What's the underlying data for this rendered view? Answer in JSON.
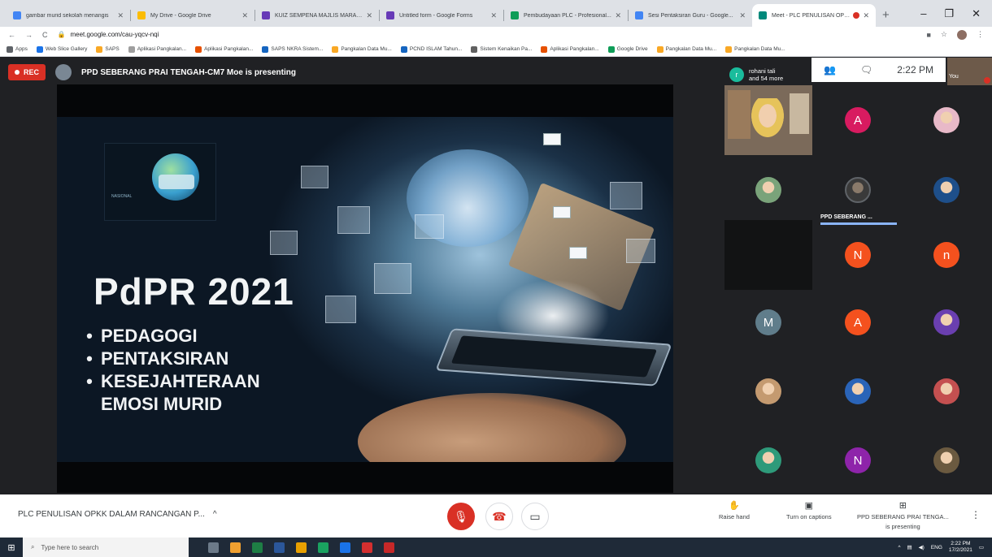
{
  "browser": {
    "tabs": [
      {
        "title": "gambar murid sekolah menangis",
        "color": "#4285f4"
      },
      {
        "title": "My Drive - Google Drive",
        "color": "#fbbc04"
      },
      {
        "title": "KUIZ SEMPENA MAJLIS MARAH...",
        "color": "#673ab7"
      },
      {
        "title": "Untitled form - Google Forms",
        "color": "#673ab7"
      },
      {
        "title": "Pembudayaan PLC - Profesional...",
        "color": "#0f9d58"
      },
      {
        "title": "Sesi Pentaksiran Guru - Google...",
        "color": "#4285f4"
      },
      {
        "title": "Meet - PLC PENULISAN OPK...",
        "color": "#00897b",
        "active": true
      }
    ],
    "new_tab": "+",
    "url": "meet.google.com/cau-yqcv-nqi",
    "bookmarks": [
      {
        "label": "Apps",
        "color": "#5f6368"
      },
      {
        "label": "Web Slice Gallery",
        "color": "#1a73e8"
      },
      {
        "label": "SAPS",
        "color": "#f9a825"
      },
      {
        "label": "Aplikasi Pangkalan...",
        "color": "#9e9e9e"
      },
      {
        "label": "Aplikasi Pangkalan...",
        "color": "#e65100"
      },
      {
        "label": "SAPS NKRA Sistem...",
        "color": "#1565c0"
      },
      {
        "label": "Pangkalan Data Mu...",
        "color": "#f9a825"
      },
      {
        "label": "PCND ISLAM Tahun...",
        "color": "#1565c0"
      },
      {
        "label": "Sistem Kenaikan Pa...",
        "color": "#616161"
      },
      {
        "label": "Aplikasi Pangkalan...",
        "color": "#e65100"
      },
      {
        "label": "Google Drive",
        "color": "#0f9d58"
      },
      {
        "label": "Pangkalan Data Mu...",
        "color": "#f9a825"
      },
      {
        "label": "Pangkalan Data Mu...",
        "color": "#f9a825"
      }
    ]
  },
  "meet": {
    "rec_label": "REC",
    "presenting_text": "PPD SEBERANG PRAI TENGAH-CM7 Moe is presenting",
    "participant_summary": {
      "initial": "r",
      "line1": "rohani tali",
      "line2": "and 54 more"
    },
    "participants_count_icon": "people-icon",
    "time": "2:22 PM",
    "you_label": "You",
    "slide": {
      "title": "PdPR 2021",
      "bullets": [
        "PEDAGOGI",
        "PENTAKSIRAN",
        "KESEJAHTERAAN"
      ],
      "bullet_continuation": "EMOSI MURID",
      "globe_caption": "NASIONAL"
    },
    "tiles": [
      {
        "type": "video"
      },
      {
        "type": "initial",
        "initial": "A",
        "color": "#d81b60"
      },
      {
        "type": "photo",
        "color": "#e8b9c8"
      },
      {
        "type": "photo",
        "color": "#7aa37a"
      },
      {
        "type": "speaker",
        "label": "PPD SEBERANG ..."
      },
      {
        "type": "photo",
        "color": "#1e4f8a"
      },
      {
        "type": "dark"
      },
      {
        "type": "initial",
        "initial": "N",
        "color": "#f4511e"
      },
      {
        "type": "initial",
        "initial": "n",
        "color": "#f4511e"
      },
      {
        "type": "initial",
        "initial": "M",
        "color": "#607d8b"
      },
      {
        "type": "initial",
        "initial": "A",
        "color": "#f4511e"
      },
      {
        "type": "photo",
        "color": "#6a3fb0"
      },
      {
        "type": "photo",
        "color": "#c49a70"
      },
      {
        "type": "photo",
        "color": "#2a64b8"
      },
      {
        "type": "photo",
        "color": "#c45050"
      },
      {
        "type": "photo",
        "color": "#2e9a7a"
      },
      {
        "type": "initial",
        "initial": "N",
        "color": "#8e24aa"
      },
      {
        "type": "photo",
        "color": "#6b5a40"
      }
    ]
  },
  "controls": {
    "meeting_name": "PLC PENULISAN OPKK DALAM RANCANGAN P...",
    "expand_icon": "^",
    "raise_hand": "Raise hand",
    "captions": "Turn on captions",
    "presenting_line1": "PPD SEBERANG PRAI TENGA...",
    "presenting_line2": "is presenting",
    "more": "⋮"
  },
  "taskbar": {
    "search_placeholder": "Type here to search",
    "lang": "ENG",
    "time": "2:22 PM",
    "date": "17/2/2021",
    "apps": [
      "#6c7a89",
      "#f0a030",
      "#1e7e45",
      "#2b579a",
      "#e8a000",
      "#1aa260",
      "#1a73e8",
      "#d32f2f",
      "#c62828"
    ]
  }
}
